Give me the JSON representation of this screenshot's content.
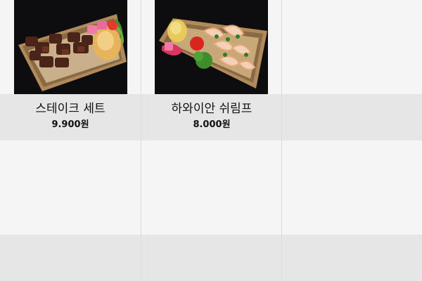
{
  "products": [
    {
      "name": "스테이크 세트",
      "price": "9.900원",
      "image_icon": "steak-box-photo"
    },
    {
      "name": "하와이안 쉬림프",
      "price": "8.000원",
      "image_icon": "shrimp-box-photo"
    }
  ],
  "colors": {
    "page_bg": "#f5f5f5",
    "label_bg": "#e6e6e6",
    "photo_bg": "#0d0d0f",
    "text": "#111111"
  }
}
